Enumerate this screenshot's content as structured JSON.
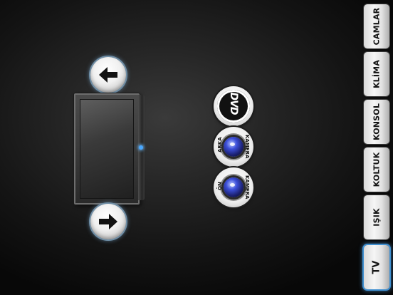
{
  "tabs": [
    {
      "label": "CAMLAR",
      "active": false
    },
    {
      "label": "KLİMA",
      "active": false
    },
    {
      "label": "KONSOL",
      "active": false
    },
    {
      "label": "KOLTUK",
      "active": false
    },
    {
      "label": "IŞIK",
      "active": false
    },
    {
      "label": "TV",
      "active": true
    }
  ],
  "sources": {
    "dvd": {
      "logo_text": "DVD"
    },
    "rear_camera": {
      "label_left": "ARKA",
      "label_right": "KAMERA"
    },
    "front_camera": {
      "label_left": "ÖN",
      "label_right": "KAMERA"
    }
  },
  "icons": {
    "prev": "arrow-left-icon",
    "next": "arrow-right-icon",
    "display": "tv-monitor-icon",
    "lens": "camera-lens-icon"
  },
  "colors": {
    "active_tab_glow": "#3f8fd0",
    "tv_led": "#4aa8ff",
    "lens_blue": "#3c4fd9"
  }
}
